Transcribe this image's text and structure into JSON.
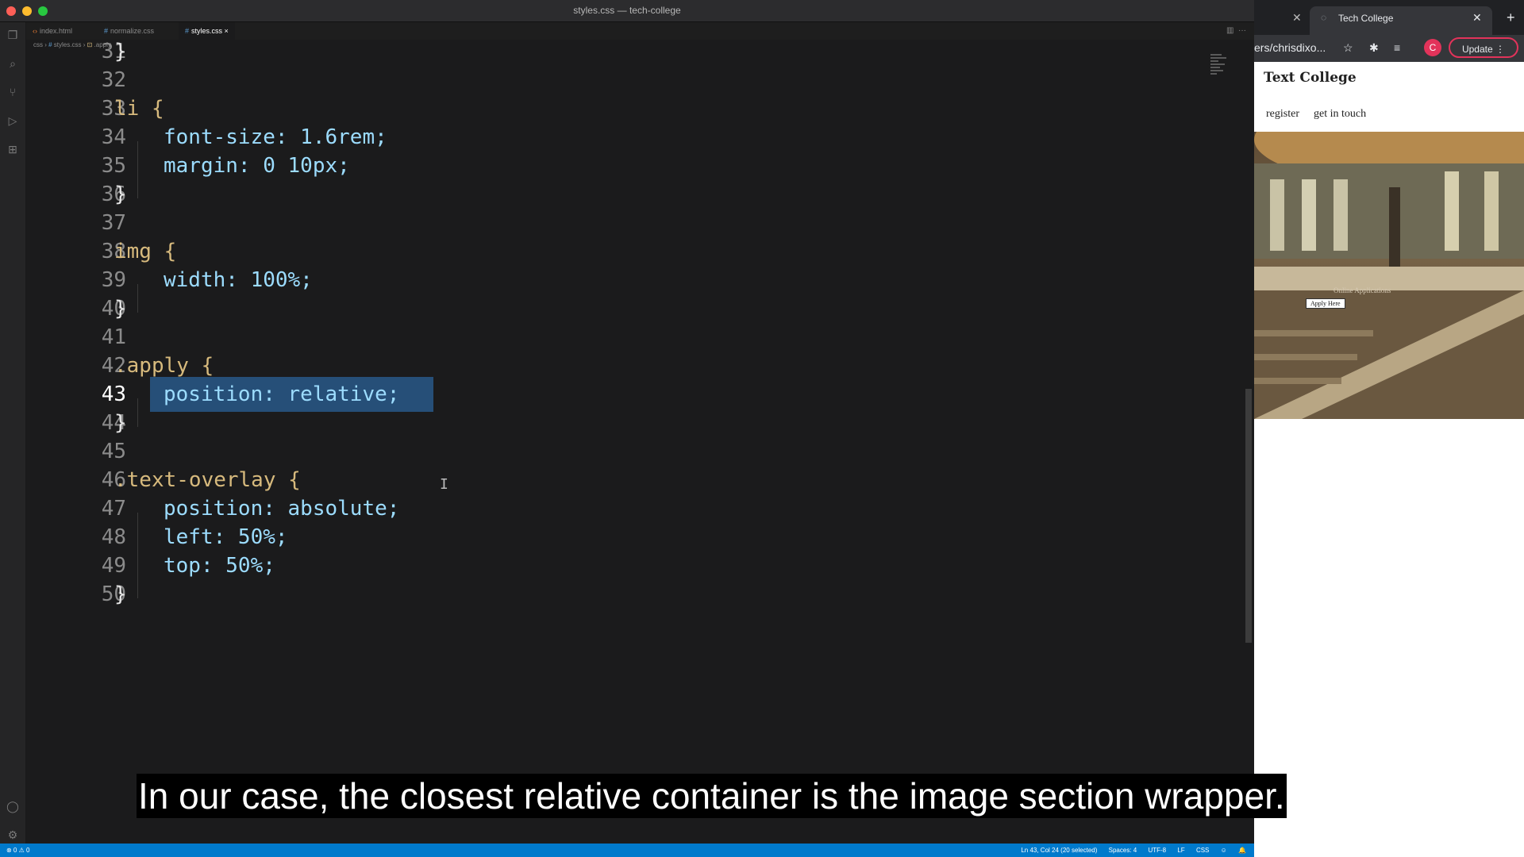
{
  "window": {
    "title": "styles.css — tech-college"
  },
  "editor": {
    "tabs": [
      {
        "label": "index.html"
      },
      {
        "label": "normalize.css"
      },
      {
        "label": "styles.css"
      }
    ],
    "breadcrumb": [
      "css",
      "styles.css",
      ".apply"
    ],
    "lines": [
      {
        "n": "31",
        "text": "}"
      },
      {
        "n": "32",
        "text": ""
      },
      {
        "n": "33",
        "text": "li {"
      },
      {
        "n": "34",
        "text": "font-size: 1.6rem;"
      },
      {
        "n": "35",
        "text": "margin: 0 10px;"
      },
      {
        "n": "36",
        "text": "}"
      },
      {
        "n": "37",
        "text": ""
      },
      {
        "n": "38",
        "text": "img {"
      },
      {
        "n": "39",
        "text": "width: 100%;"
      },
      {
        "n": "40",
        "text": "}"
      },
      {
        "n": "41",
        "text": ""
      },
      {
        "n": "42",
        "text": ".apply {"
      },
      {
        "n": "43",
        "text": "position: relative;"
      },
      {
        "n": "44",
        "text": "}"
      },
      {
        "n": "45",
        "text": ""
      },
      {
        "n": "46",
        "text": ".text-overlay {"
      },
      {
        "n": "47",
        "text": "position: absolute;"
      },
      {
        "n": "48",
        "text": "left: 50%;"
      },
      {
        "n": "49",
        "text": "top: 50%;"
      },
      {
        "n": "50",
        "text": "}"
      }
    ],
    "cursor": "I",
    "status": {
      "left": "⊗ 0  ⚠ 0",
      "position": "Ln 43, Col 24 (20 selected)",
      "spaces": "Spaces: 4",
      "encoding": "UTF-8",
      "eol": "LF",
      "language": "CSS"
    }
  },
  "browser": {
    "tab_title": "Tech College",
    "url": "ers/chrisdixo...",
    "update_label": "Update",
    "avatar_letter": "C",
    "page": {
      "site_title": "Text College",
      "nav": [
        "register",
        "get in touch"
      ],
      "apply_button": "Apply Here",
      "overlay_text": "Online Applications"
    }
  },
  "caption": "In our case, the closest relative container is the image section wrapper.",
  "colors": {
    "accent": "#007acc",
    "selection": "#264f78",
    "selector": "#d7ba7d",
    "property": "#9cdcfe",
    "number": "#b5cea8",
    "value": "#ce9178"
  }
}
